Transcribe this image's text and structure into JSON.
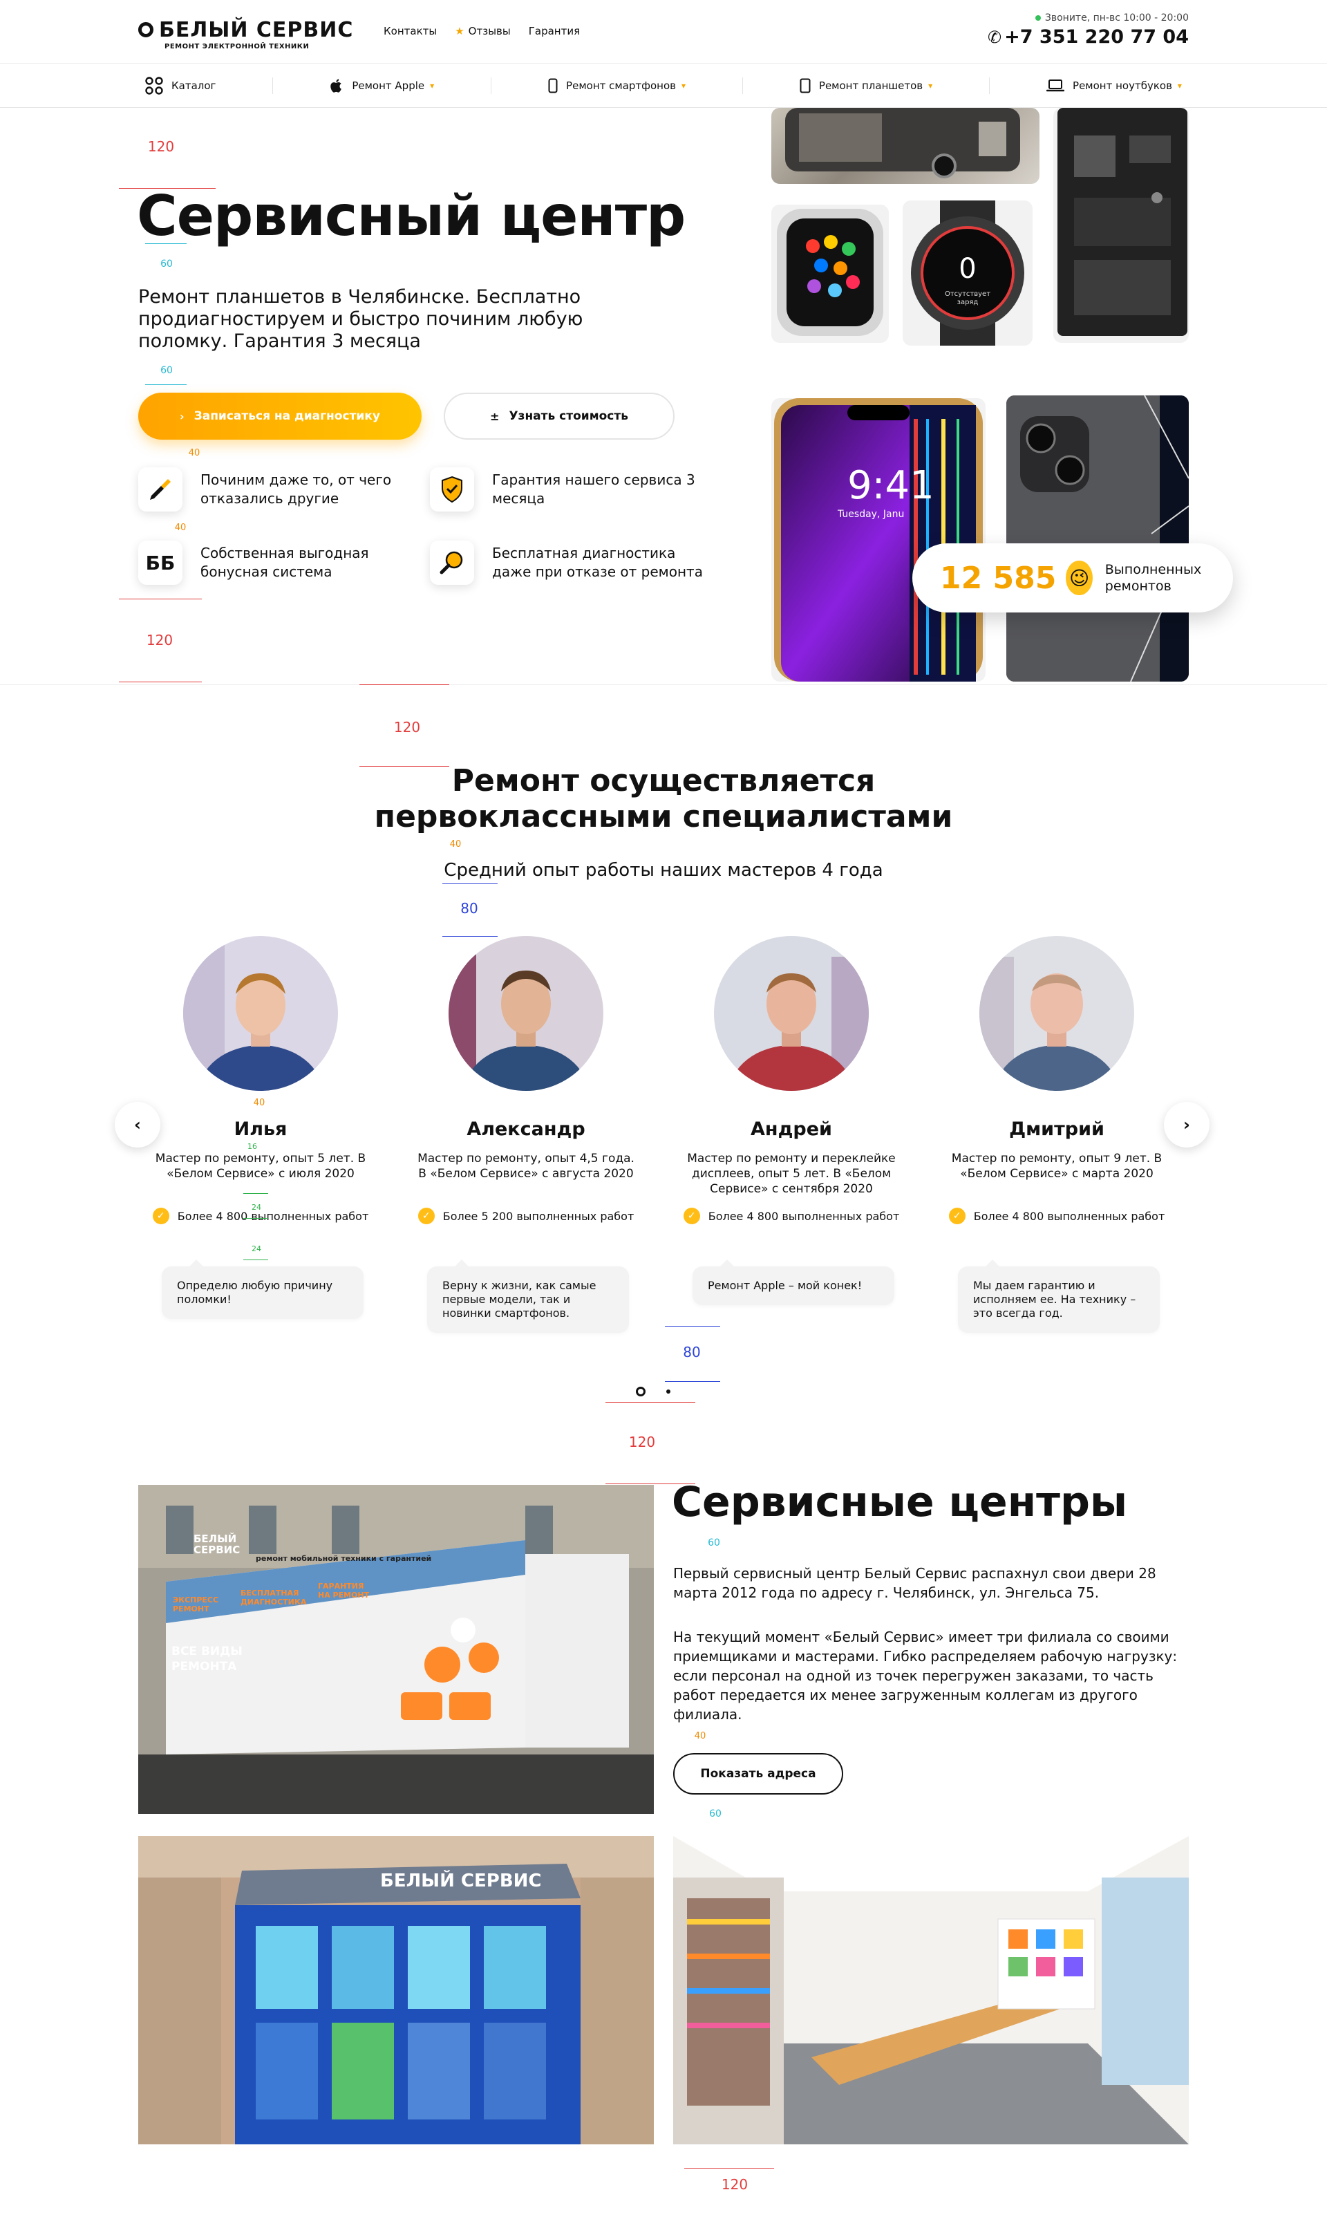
{
  "header": {
    "logo_text": "БЕЛЫЙ СЕРВИС",
    "logo_sub": "РЕМОНТ ЭЛЕКТРОННОЙ ТЕХНИКИ",
    "links": [
      "Контакты",
      "Отзывы",
      "Гарантия"
    ],
    "work_hours": "Звоните, пн-вс 10:00 - 20:00",
    "phone": "+7 351 220 77 04"
  },
  "nav": {
    "items": [
      {
        "label": "Каталог",
        "icon": "grid-icon"
      },
      {
        "label": "Ремонт Apple",
        "icon": "apple-icon"
      },
      {
        "label": "Ремонт смартфонов",
        "icon": "phone-icon"
      },
      {
        "label": "Ремонт планшетов",
        "icon": "tablet-icon"
      },
      {
        "label": "Ремонт ноутбуков",
        "icon": "laptop-icon"
      }
    ]
  },
  "hero": {
    "title": "Сервисный центр",
    "description": "Ремонт планшетов в Челябинске. Бесплатно продиагностируем и быстро починим любую поломку. Гарантия 3 месяца",
    "primary_button": "Записаться на диагностику",
    "secondary_button": "Узнать стоимость",
    "features": [
      {
        "text": "Починим даже то, от чего отказались другие",
        "icon": "screwdriver-icon"
      },
      {
        "text": "Гарантия нашего сервиса 3 месяца",
        "icon": "shield-icon"
      },
      {
        "text": "Собственная выгодная бонусная система",
        "icon": "bb-icon",
        "mark": "ББ"
      },
      {
        "text": "Бесплатная диагностика даже при отказе от ремонта",
        "icon": "magnifier-icon"
      }
    ],
    "repairs_count": "12 585",
    "repairs_label": "Выполненных ремонтов",
    "phone_screen_time": "9:41",
    "phone_screen_date": "Tuesday, Janu",
    "watch_text": "Отсутствует заряд",
    "watch_digit": "0"
  },
  "guides": {
    "v120": "120",
    "v60": "60",
    "v40": "40",
    "v80": "80",
    "v16": "16",
    "v24": "24"
  },
  "specialists": {
    "title": "Ремонт осуществляется первоклассными специалистами",
    "subtitle": "Средний опыт работы наших мастеров 4 года",
    "masters": [
      {
        "name": "Илья",
        "experience": "Мастер по ремонту, опыт 5 лет. В «Белом Сервисе» с июля 2020",
        "works": "Более 4 800 выполненных работ",
        "quote": "Определю любую причину поломки!"
      },
      {
        "name": "Александр",
        "experience": "Мастер по ремонту, опыт 4,5 года. В «Белом Сервисе» с августа 2020",
        "works": "Более 5 200 выполненных работ",
        "quote": "Верну к жизни, как самые первые модели, так и новинки смартфонов."
      },
      {
        "name": "Андрей",
        "experience": "Мастер по ремонту и переклейке дисплеев, опыт 5 лет. В «Белом Сервисе» с сентября 2020",
        "works": "Более 4 800 выполненных работ",
        "quote": "Ремонт Apple – мой конек!"
      },
      {
        "name": "Дмитрий",
        "experience": "Мастер по ремонту, опыт 9 лет. В «Белом Сервисе» с марта 2020",
        "works": "Более 4 800 выполненных работ",
        "quote": "Мы даем гарантию и исполняем ее. На технику – это всегда год."
      }
    ]
  },
  "service_centers": {
    "title": "Сервисные центры",
    "paragraph1": "Первый сервисный центр Белый Сервис распахнул свои двери 28 марта 2012 года по адресу г. Челябинск, ул. Энгельса 75.",
    "paragraph2": "На текущий момент «Белый Сервис» имеет три филиала со своими приемщиками и мастерами. Гибко распределяем рабочую нагрузку: если персонал на одной из точек перегружен заказами, то часть работ передается их менее загруженным коллегам из другого филиала.",
    "button": "Показать адреса",
    "storefront_brand": "БЕЛЫЙ СЕРВИС",
    "storefront_slogan": "ремонт мобильной техники с гарантией",
    "storefront_all_models": "ВСЕ ВИДЫ РЕМОНТА",
    "storefront_express": "ЭКСПРЕСС РЕМОНТ",
    "storefront_diagnostics": "БЕСПЛАТНАЯ ДИАГНОСТИКА",
    "storefront_warranty": "ГАРАНТИЯ НА РЕМОНТ"
  },
  "colors": {
    "accent": "#ffb100",
    "accent_light": "#ffc400",
    "text": "#111111",
    "guide_red": "#e23c3c",
    "guide_blue": "#2d44d8"
  }
}
